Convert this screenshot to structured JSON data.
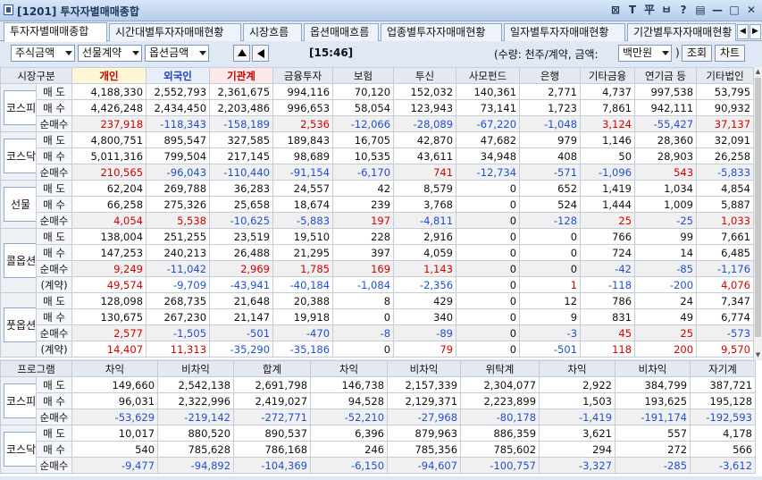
{
  "window": {
    "title": "[1201] 투자자별매매종합",
    "buttons": [
      "⊠",
      "T",
      "平",
      "ㅂ",
      "?",
      "▤",
      "—",
      "□",
      "✕"
    ]
  },
  "tabs": [
    "투자자별매매종합",
    "시간대별투자자매매현황",
    "시장흐름",
    "옵션매매흐름",
    "업종별투자자매매현황",
    "일자별투자자매매현황",
    "기간별투자자매매현황"
  ],
  "toolbar": {
    "select1": "주식금액",
    "select2": "선물계약",
    "select3": "옵션금액",
    "time": "[15:46]",
    "unit_text": "(수량: 천주/계약, 금액:",
    "unit_select": "백만원",
    "unit_close": ")",
    "query_button": "조회",
    "chart_button": "차트"
  },
  "top_table": {
    "headers": [
      "시장구분",
      "",
      "개인",
      "외국인",
      "기관계",
      "금융투자",
      "보험",
      "투신",
      "사모펀드",
      "은행",
      "기타금융",
      "연기금 등",
      "기타법인"
    ],
    "groups": [
      {
        "name": "코스피",
        "rows": [
          {
            "label": "매 도",
            "values": [
              "4,188,330",
              "2,552,793",
              "2,361,675",
              "994,116",
              "70,120",
              "152,032",
              "140,361",
              "2,771",
              "4,737",
              "997,538",
              "53,795"
            ]
          },
          {
            "label": "매 수",
            "values": [
              "4,426,248",
              "2,434,450",
              "2,203,486",
              "996,653",
              "58,054",
              "123,943",
              "73,141",
              "1,723",
              "7,861",
              "942,111",
              "90,932"
            ]
          },
          {
            "label": "순매수",
            "net": true,
            "values": [
              "237,918",
              "-118,343",
              "-158,189",
              "2,536",
              "-12,066",
              "-28,089",
              "-67,220",
              "-1,048",
              "3,124",
              "-55,427",
              "37,137"
            ]
          }
        ]
      },
      {
        "name": "코스닥",
        "rows": [
          {
            "label": "매 도",
            "values": [
              "4,800,751",
              "895,547",
              "327,585",
              "189,843",
              "16,705",
              "42,870",
              "47,682",
              "979",
              "1,146",
              "28,360",
              "32,091"
            ]
          },
          {
            "label": "매 수",
            "values": [
              "5,011,316",
              "799,504",
              "217,145",
              "98,689",
              "10,535",
              "43,611",
              "34,948",
              "408",
              "50",
              "28,903",
              "26,258"
            ]
          },
          {
            "label": "순매수",
            "net": true,
            "values": [
              "210,565",
              "-96,043",
              "-110,440",
              "-91,154",
              "-6,170",
              "741",
              "-12,734",
              "-571",
              "-1,096",
              "543",
              "-5,833"
            ]
          }
        ]
      },
      {
        "name": "선물",
        "rows": [
          {
            "label": "매 도",
            "values": [
              "62,204",
              "269,788",
              "36,283",
              "24,557",
              "42",
              "8,579",
              "0",
              "652",
              "1,419",
              "1,034",
              "4,854"
            ]
          },
          {
            "label": "매 수",
            "values": [
              "66,258",
              "275,326",
              "25,658",
              "18,674",
              "239",
              "3,768",
              "0",
              "524",
              "1,444",
              "1,009",
              "5,887"
            ]
          },
          {
            "label": "순매수",
            "net": true,
            "values": [
              "4,054",
              "5,538",
              "-10,625",
              "-5,883",
              "197",
              "-4,811",
              "0",
              "-128",
              "25",
              "-25",
              "1,033"
            ]
          }
        ]
      },
      {
        "name": "콜옵션",
        "rows": [
          {
            "label": "매 도",
            "values": [
              "138,004",
              "251,255",
              "23,519",
              "19,510",
              "228",
              "2,916",
              "0",
              "0",
              "766",
              "99",
              "7,661"
            ]
          },
          {
            "label": "매 수",
            "values": [
              "147,253",
              "240,213",
              "26,488",
              "21,295",
              "397",
              "4,059",
              "0",
              "0",
              "724",
              "14",
              "6,485"
            ]
          },
          {
            "label": "순매수",
            "net": true,
            "values": [
              "9,249",
              "-11,042",
              "2,969",
              "1,785",
              "169",
              "1,143",
              "0",
              "0",
              "-42",
              "-85",
              "-1,176"
            ]
          },
          {
            "label": "(계약)",
            "values": [
              "49,574",
              "-9,709",
              "-43,941",
              "-40,184",
              "-1,084",
              "-2,356",
              "0",
              "1",
              "-118",
              "-200",
              "4,076"
            ]
          }
        ]
      },
      {
        "name": "풋옵션",
        "rows": [
          {
            "label": "매 도",
            "values": [
              "128,098",
              "268,735",
              "21,648",
              "20,388",
              "8",
              "429",
              "0",
              "12",
              "786",
              "24",
              "7,347"
            ]
          },
          {
            "label": "매 수",
            "values": [
              "130,675",
              "267,230",
              "21,147",
              "19,918",
              "0",
              "340",
              "0",
              "9",
              "831",
              "49",
              "6,774"
            ]
          },
          {
            "label": "순매수",
            "net": true,
            "values": [
              "2,577",
              "-1,505",
              "-501",
              "-470",
              "-8",
              "-89",
              "0",
              "-3",
              "45",
              "25",
              "-573"
            ]
          },
          {
            "label": "(계약)",
            "values": [
              "14,407",
              "11,313",
              "-35,290",
              "-35,186",
              "0",
              "79",
              "0",
              "-501",
              "118",
              "200",
              "9,570"
            ]
          }
        ]
      }
    ]
  },
  "program_table": {
    "headers": [
      "프로그램",
      "",
      "차익",
      "비차익",
      "합계",
      "차익",
      "비차익",
      "위탁계",
      "차익",
      "비차익",
      "자기계"
    ],
    "groups": [
      {
        "name": "코스피",
        "rows": [
          {
            "label": "매 도",
            "values": [
              "149,660",
              "2,542,138",
              "2,691,798",
              "146,738",
              "2,157,339",
              "2,304,077",
              "2,922",
              "384,799",
              "387,721"
            ]
          },
          {
            "label": "매 수",
            "values": [
              "96,031",
              "2,322,996",
              "2,419,027",
              "94,528",
              "2,129,371",
              "2,223,899",
              "1,503",
              "193,625",
              "195,128"
            ]
          },
          {
            "label": "순매수",
            "net": true,
            "values": [
              "-53,629",
              "-219,142",
              "-272,771",
              "-52,210",
              "-27,968",
              "-80,178",
              "-1,419",
              "-191,174",
              "-192,593"
            ]
          }
        ]
      },
      {
        "name": "코스닥",
        "rows": [
          {
            "label": "매 도",
            "values": [
              "10,017",
              "880,520",
              "890,537",
              "6,396",
              "879,963",
              "886,359",
              "3,621",
              "557",
              "4,178"
            ]
          },
          {
            "label": "매 수",
            "values": [
              "540",
              "785,628",
              "786,168",
              "246",
              "785,356",
              "785,602",
              "294",
              "272",
              "566"
            ]
          },
          {
            "label": "순매수",
            "net": true,
            "values": [
              "-9,477",
              "-94,892",
              "-104,369",
              "-6,150",
              "-94,607",
              "-100,757",
              "-3,327",
              "-285",
              "-3,612"
            ]
          }
        ]
      }
    ]
  }
}
